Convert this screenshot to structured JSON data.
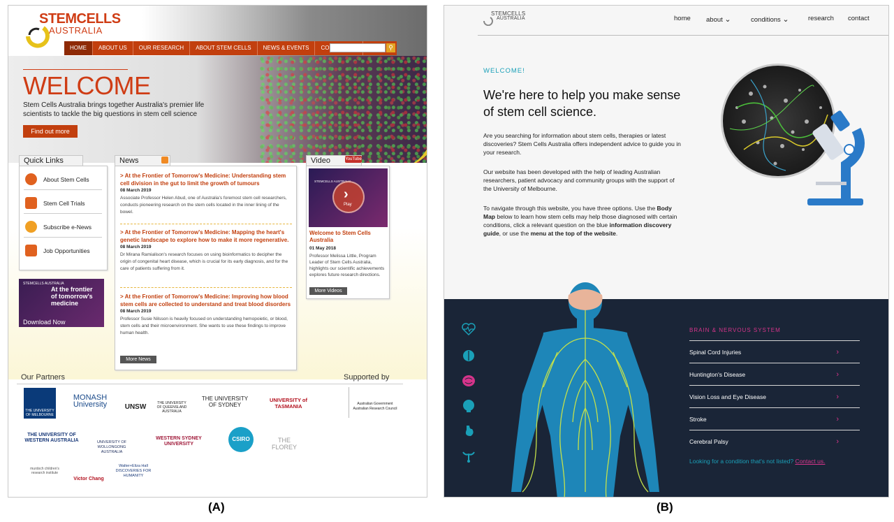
{
  "panel_a": {
    "logo": {
      "line1": "STEMCELLS",
      "line2": "AUSTRALIA"
    },
    "nav": [
      "HOME",
      "ABOUT US",
      "OUR RESEARCH",
      "ABOUT STEM CELLS",
      "NEWS & EVENTS",
      "CONTACT US"
    ],
    "hero": {
      "title": "WELCOME",
      "text": "Stem Cells Australia brings together Australia's premier life scientists to tackle the big questions in stem cell science",
      "button": "Find out more"
    },
    "quick_links": {
      "title": "Quick Links",
      "items": [
        "About Stem Cells",
        "Stem Cell Trials",
        "Subscribe e-News",
        "Job Opportunities"
      ]
    },
    "promo": {
      "logo": "STEMCELLS AUSTRALIA",
      "text": "At the frontier of tomorrow's medicine",
      "cta": "Download Now"
    },
    "news": {
      "title": "News",
      "items": [
        {
          "title": "> At the Frontier of Tomorrow's Medicine: Understanding stem cell division in the gut to limit the growth of tumours",
          "date": "08 March 2019",
          "body": "Associate Professor Helen Abud, one of Australia's foremost stem cell researchers, conducts pioneering research on the stem cells located in the inner lining of the bowel."
        },
        {
          "title": "> At the Frontier of Tomorrow's Medicine: Mapping the heart's genetic landscape to explore how to make it more regenerative.",
          "date": "08 March 2019",
          "body": "Dr Mirana Ramialison's research focuses on using bioinformatics to decipher the origin of congenital heart disease, which is crucial for its early diagnosis, and for the care of patients suffering from it."
        },
        {
          "title": "> At the Frontier of Tomorrow's Medicine: Improving how blood stem cells are collected to understand and treat blood disorders",
          "date": "08 March 2019",
          "body": "Professor Susie Nilsson is heavily focused on understanding hemopoietic, or blood, stem cells and their microenvironment. She wants to use these findings to improve human health."
        }
      ],
      "more": "More News"
    },
    "video": {
      "title": "Video",
      "badge": "YouTube",
      "play": "Play",
      "thumb_logo": "STEMCELLS AUSTRALIA",
      "item_title": "Welcome to Stem Cells Australia",
      "date": "01 May 2018",
      "body": "Professor Melissa Little, Program Leader of Stem Cells Australia, highlights our scientific achievements explores future research directions.",
      "more": "More Videos"
    },
    "partners": {
      "title": "Our Partners",
      "supported": "Supported by",
      "row1": [
        "THE UNIVERSITY OF MELBOURNE",
        "MONASH University",
        "UNSW",
        "THE UNIVERSITY OF QUEENSLAND AUSTRALIA",
        "THE UNIVERSITY OF SYDNEY",
        "UNIVERSITY of TASMANIA"
      ],
      "row2": [
        "THE UNIVERSITY OF WESTERN AUSTRALIA",
        "UNIVERSITY OF WOLLONGONG AUSTRALIA",
        "WESTERN SYDNEY UNIVERSITY",
        "CSIRO",
        "THE FLOREY"
      ],
      "row3": [
        "murdoch children's research institute",
        "Victor Chang",
        "Walter+Eliza Hall DISCOVERIES FOR HUMANITY"
      ],
      "support": "Australian Government Australian Research Council"
    }
  },
  "panel_b": {
    "logo": {
      "line1": "STEMCELLS",
      "line2": "AUSTRALIA"
    },
    "nav": {
      "home": "home",
      "about": "about",
      "conditions": "conditions",
      "research": "research",
      "contact": "contact"
    },
    "welcome": "WELCOME!",
    "headline": "We're here to help you make sense of stem cell science.",
    "para1": "Are you searching for information about stem cells, therapies or latest discoveries? Stem Cells Australia offers independent advice to guide you in your research.",
    "para2": "Our website has been developed with the help of leading Australian researchers, patient advocacy and community groups with the support of the University of Melbourne.",
    "para3_a": "To navigate through this website, you have three options. Use the ",
    "para3_b": "Body Map",
    "para3_c": " below to learn how stem cells may help those diagnosed with certain conditions, click a relevant question on the blue ",
    "para3_d": "information discovery guide",
    "para3_e": ", or use the ",
    "para3_f": "menu at the top of the website",
    "para3_g": ".",
    "section": "BRAIN & NERVOUS SYSTEM",
    "conditions": [
      "Spinal Cord Injuries",
      "Huntington's Disease",
      "Vision Loss and Eye Disease",
      "Stroke",
      "Cerebral Palsy"
    ],
    "not_listed": "Looking for a condition that's not listed?",
    "contact_us": "Contact us.",
    "side_icons": [
      "heart-icon",
      "lungs-icon",
      "brain-icon",
      "head-icon",
      "stomach-icon",
      "uterus-icon"
    ]
  },
  "captions": {
    "a": "(A)",
    "b": "(B)"
  },
  "colors": {
    "a_accent": "#c23f0e",
    "b_teal": "#1aa0b8",
    "b_pink": "#d5348a",
    "b_dark": "#1a2537"
  }
}
